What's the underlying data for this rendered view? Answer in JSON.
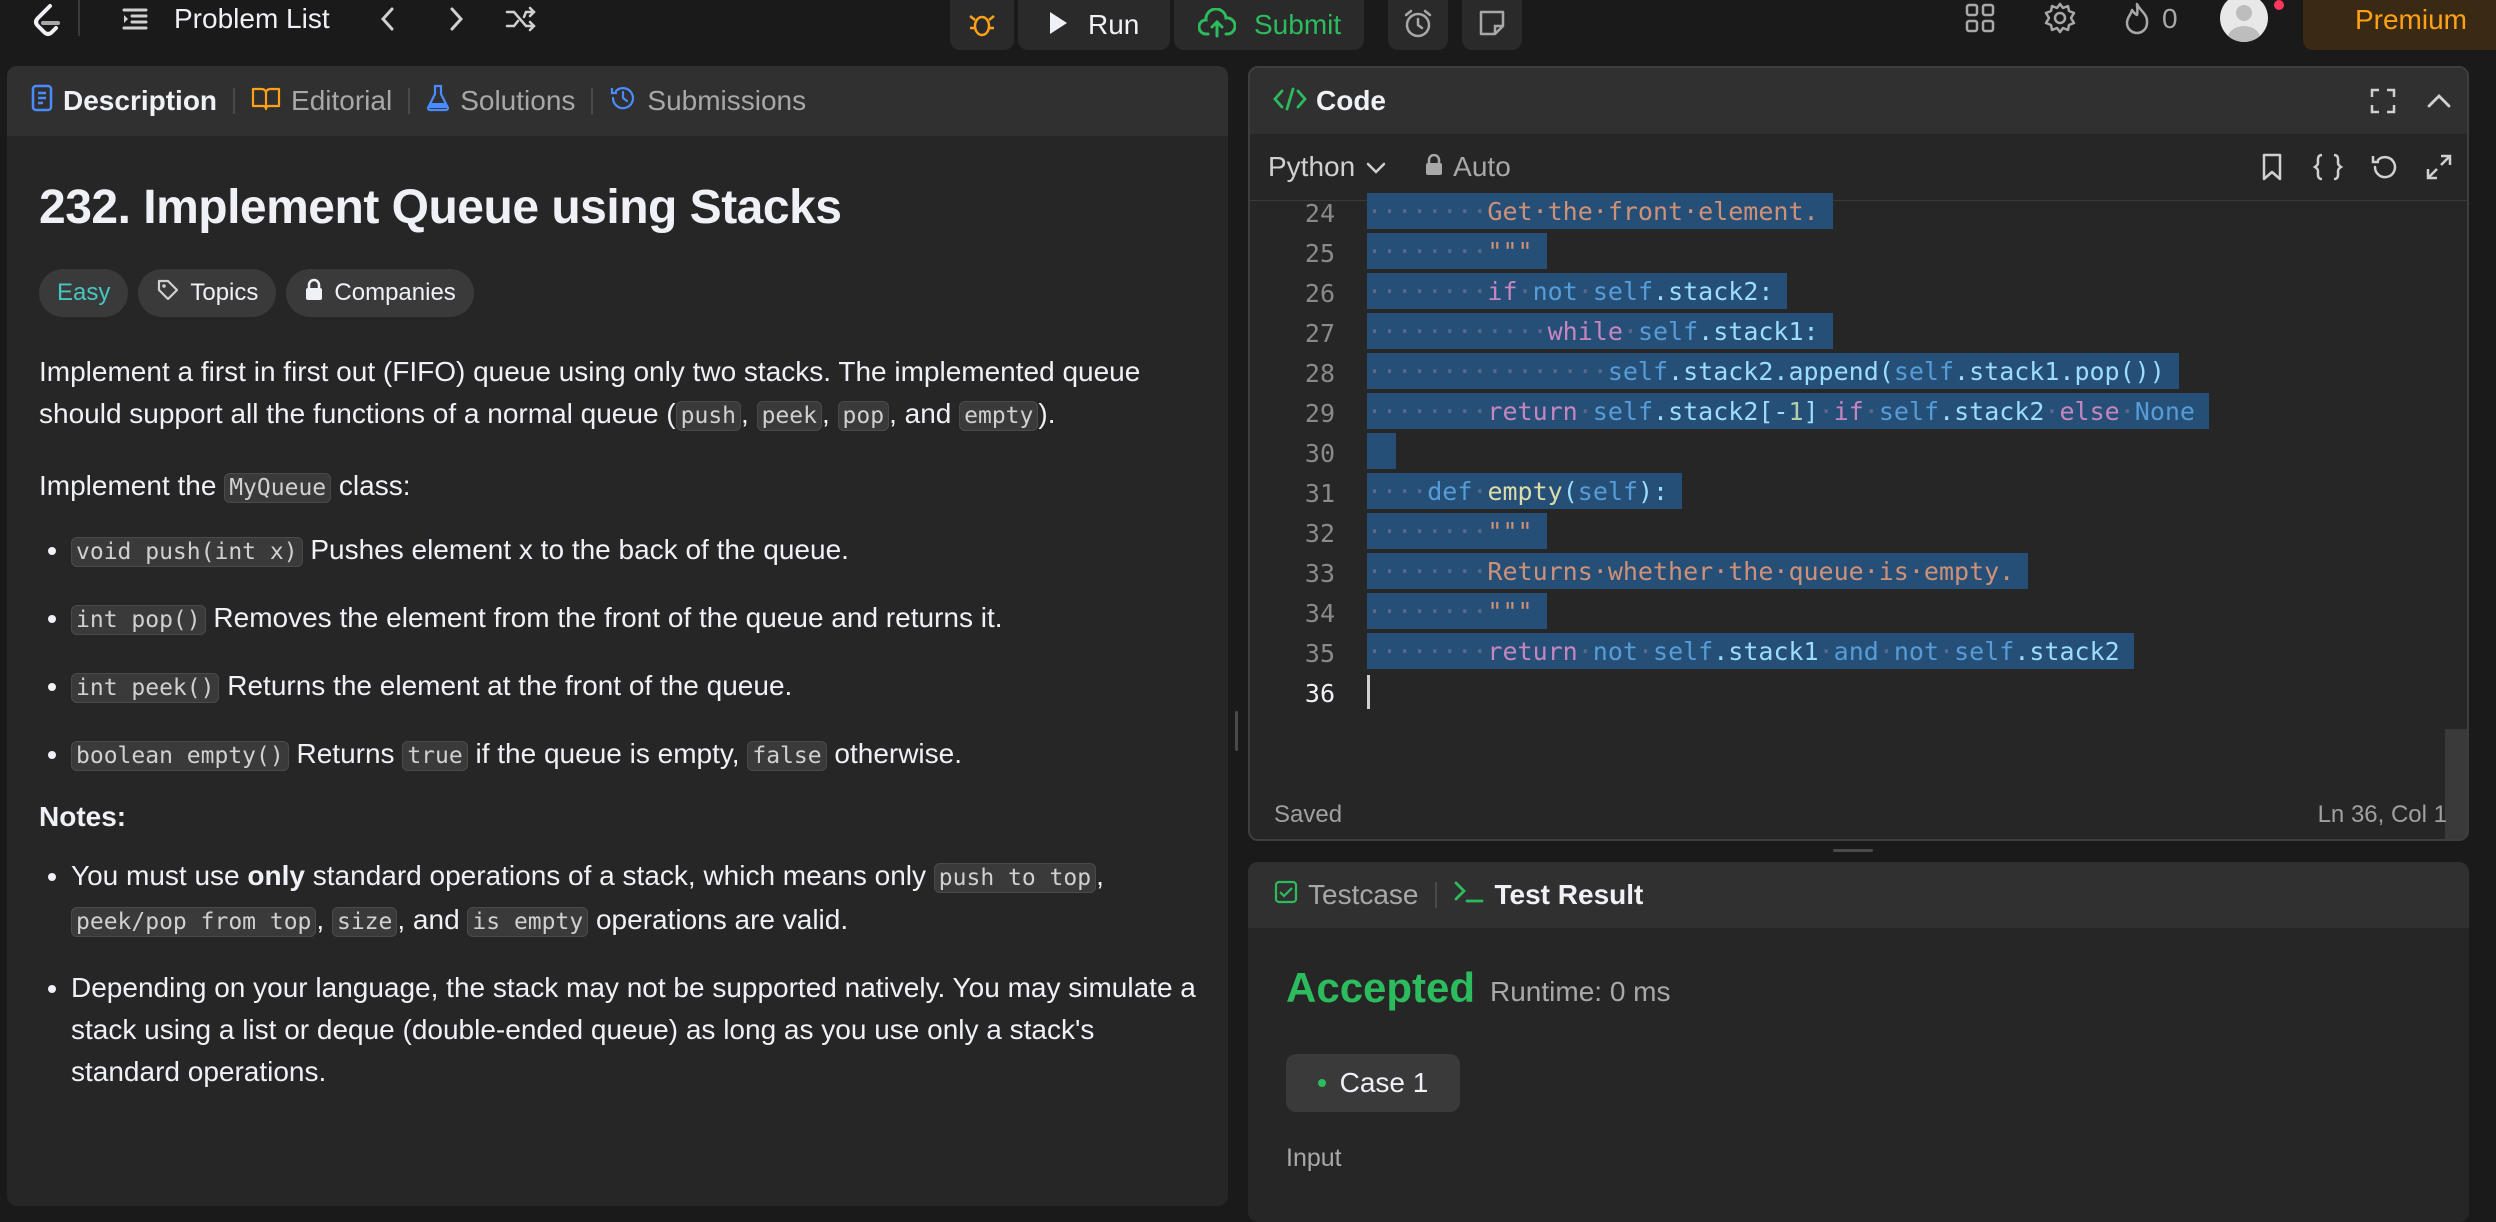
{
  "topbar": {
    "nav_title": "Problem List",
    "run_label": "Run",
    "submit_label": "Submit",
    "streak_count": "0",
    "premium_label": "Premium"
  },
  "left": {
    "tabs": [
      {
        "label": "Description"
      },
      {
        "label": "Editorial"
      },
      {
        "label": "Solutions"
      },
      {
        "label": "Submissions"
      }
    ],
    "title": "232. Implement Queue using Stacks",
    "tags": {
      "difficulty": "Easy",
      "topics": "Topics",
      "companies": "Companies"
    },
    "intro": {
      "t1": "Implement a first in first out (FIFO) queue using only two stacks. The implemented queue should support all the functions of a normal queue (",
      "c1": "push",
      "s1": ", ",
      "c2": "peek",
      "s2": ", ",
      "c3": "pop",
      "s3": ", and ",
      "c4": "empty",
      "s4": ")."
    },
    "impl": {
      "t1": "Implement the ",
      "c1": "MyQueue",
      "t2": " class:"
    },
    "methods": [
      {
        "code": "void push(int x)",
        "text": " Pushes element x to the back of the queue."
      },
      {
        "code": "int pop()",
        "text": " Removes the element from the front of the queue and returns it."
      },
      {
        "code": "int peek()",
        "text": " Returns the element at the front of the queue."
      }
    ],
    "empty_item": {
      "c1": "boolean empty()",
      "t1": " Returns ",
      "c2": "true",
      "t2": " if the queue is empty, ",
      "c3": "false",
      "t3": " otherwise."
    },
    "notes_label": "Notes:",
    "note1": {
      "t1": "You must use ",
      "b1": "only",
      "t2": " standard operations of a stack, which means only ",
      "c1": "push to top",
      "t3": ", ",
      "c2": "peek/pop from top",
      "t4": ", ",
      "c3": "size",
      "t5": ", and ",
      "c4": "is empty",
      "t6": " operations are valid."
    },
    "note2": "Depending on your language, the stack may not be supported natively. You may simulate a stack using a list or deque (double-ended queue) as long as you use only a stack's standard operations."
  },
  "code": {
    "header_label": "Code",
    "language": "Python",
    "mode": "Auto",
    "status": "Saved",
    "cursor": "Ln 36, Col 1",
    "lines": [
      {
        "n": "24",
        "dots": "········",
        "rest": [
          [
            "str",
            "Get·the·front·element."
          ]
        ]
      },
      {
        "n": "25",
        "dots": "········",
        "rest": [
          [
            "str",
            "\"\"\""
          ]
        ]
      },
      {
        "n": "26",
        "dots": "········",
        "rest": [
          [
            "kw",
            "if"
          ],
          [
            "dot",
            "·"
          ],
          [
            "op",
            "not"
          ],
          [
            "dot",
            "·"
          ],
          [
            "self",
            "self"
          ],
          [
            "plain",
            ".stack2:"
          ]
        ]
      },
      {
        "n": "27",
        "dots": "············",
        "rest": [
          [
            "kw",
            "while"
          ],
          [
            "dot",
            "·"
          ],
          [
            "self",
            "self"
          ],
          [
            "plain",
            ".stack1:"
          ]
        ]
      },
      {
        "n": "28",
        "dots": "················",
        "rest": [
          [
            "self",
            "self"
          ],
          [
            "plain",
            ".stack2.append("
          ],
          [
            "self",
            "self"
          ],
          [
            "plain",
            ".stack1.pop())"
          ]
        ]
      },
      {
        "n": "29",
        "dots": "········",
        "rest": [
          [
            "kw",
            "return"
          ],
          [
            "dot",
            "·"
          ],
          [
            "self",
            "self"
          ],
          [
            "plain",
            ".stack2[-"
          ],
          [
            "num",
            "1"
          ],
          [
            "plain",
            "]"
          ],
          [
            "dot",
            "·"
          ],
          [
            "kw",
            "if"
          ],
          [
            "dot",
            "·"
          ],
          [
            "self",
            "self"
          ],
          [
            "plain",
            ".stack2"
          ],
          [
            "dot",
            "·"
          ],
          [
            "kw",
            "else"
          ],
          [
            "dot",
            "·"
          ],
          [
            "def",
            "None"
          ]
        ]
      },
      {
        "n": "30",
        "dots": "",
        "rest": []
      },
      {
        "n": "31",
        "dots": "····",
        "rest": [
          [
            "def",
            "def"
          ],
          [
            "dot",
            "·"
          ],
          [
            "fn",
            "empty"
          ],
          [
            "plain",
            "("
          ],
          [
            "self",
            "self"
          ],
          [
            "plain",
            "):"
          ]
        ]
      },
      {
        "n": "32",
        "dots": "········",
        "rest": [
          [
            "str",
            "\"\"\""
          ]
        ]
      },
      {
        "n": "33",
        "dots": "········",
        "rest": [
          [
            "str",
            "Returns·whether·the·queue·is·empty."
          ]
        ]
      },
      {
        "n": "34",
        "dots": "········",
        "rest": [
          [
            "str",
            "\"\"\""
          ]
        ]
      },
      {
        "n": "35",
        "dots": "········",
        "rest": [
          [
            "kw",
            "return"
          ],
          [
            "dot",
            "·"
          ],
          [
            "op",
            "not"
          ],
          [
            "dot",
            "·"
          ],
          [
            "self",
            "self"
          ],
          [
            "plain",
            ".stack1"
          ],
          [
            "dot",
            "·"
          ],
          [
            "op",
            "and"
          ],
          [
            "dot",
            "·"
          ],
          [
            "op",
            "not"
          ],
          [
            "dot",
            "·"
          ],
          [
            "self",
            "self"
          ],
          [
            "plain",
            ".stack2"
          ]
        ]
      },
      {
        "n": "36",
        "dots": "",
        "rest": []
      }
    ]
  },
  "result": {
    "tab_testcase": "Testcase",
    "tab_result": "Test Result",
    "status": "Accepted",
    "runtime": "Runtime: 0 ms",
    "case_label": "Case 1",
    "input_label": "Input"
  },
  "colors": {
    "accent_orange": "#ffa116",
    "accepted_green": "#2cbb5d",
    "easy_teal": "#46c6c2",
    "selection": "#264f78",
    "blue": "#569cd6"
  }
}
